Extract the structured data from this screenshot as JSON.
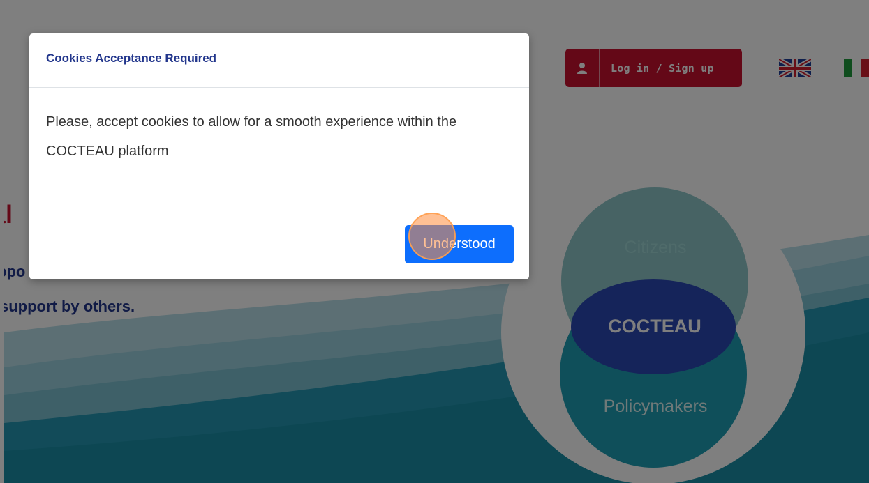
{
  "header": {
    "login_label": "Log in / Sign up"
  },
  "hero": {
    "heading": "al",
    "line1": "ppo",
    "line2": "support by others."
  },
  "venn": {
    "citizens": "Citizens",
    "center": "COCTEAU",
    "policymakers": "Policymakers"
  },
  "modal": {
    "title": "Cookies Acceptance Required",
    "body": "Please, accept cookies to allow for a smooth experience within the COCTEAU platform",
    "button_label": "Understood"
  },
  "colors": {
    "brand_red": "#c8102e",
    "brand_blue": "#22368c",
    "button_blue": "#0d6efd",
    "wave_teal": "#1a8fa6"
  },
  "icons": {
    "login": "user-icon",
    "lang_en": "uk-flag-icon",
    "lang_it": "italy-flag-icon"
  }
}
